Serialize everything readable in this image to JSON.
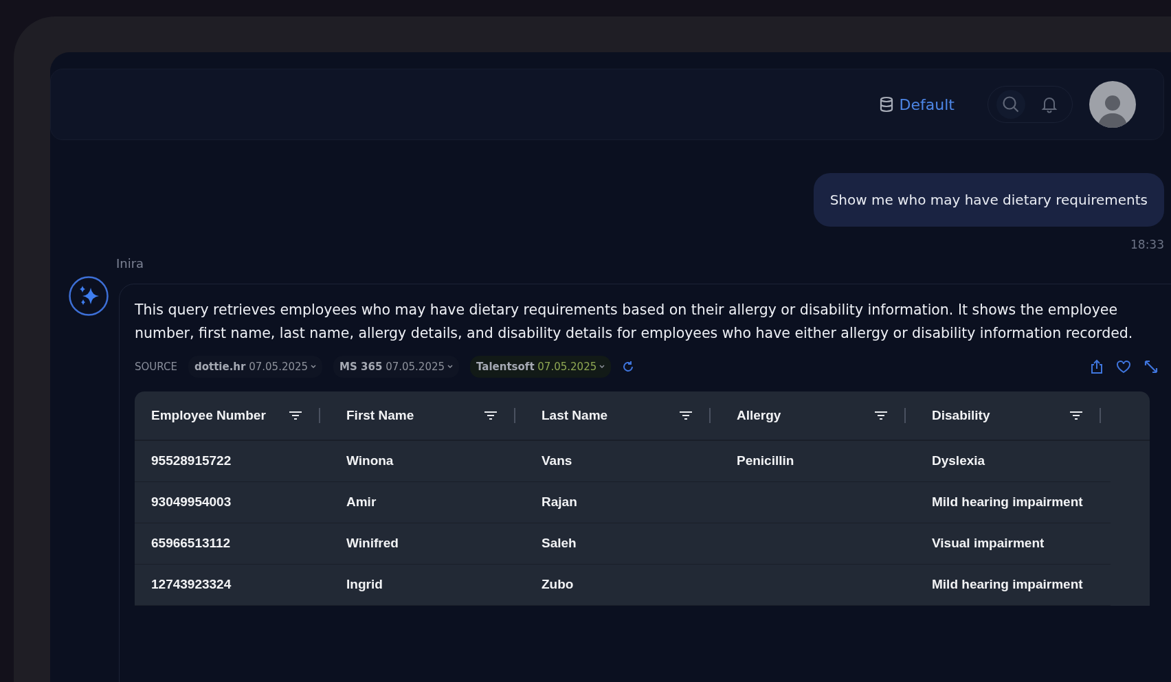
{
  "header": {
    "workspace": "Default"
  },
  "user_message": {
    "text": "Show me who may have dietary requirements",
    "time": "18:33"
  },
  "assistant": {
    "name": "Inira",
    "text": "This query retrieves employees who may have dietary requirements based on their allergy or disability information. It shows the employee number, first name, last name, allergy details, and disability details for employees who have either allergy or disability information recorded.",
    "source_label": "SOURCE",
    "sources": [
      {
        "name": "dottie.hr",
        "date": "07.05.2025",
        "active": false
      },
      {
        "name": "MS 365",
        "date": "07.05.2025",
        "active": false
      },
      {
        "name": "Talentsoft",
        "date": "07.05.2025",
        "active": true
      }
    ],
    "table": {
      "columns": [
        "Employee Number",
        "First Name",
        "Last Name",
        "Allergy",
        "Disability"
      ],
      "rows": [
        [
          "95528915722",
          "Winona",
          "Vans",
          "Penicillin",
          "Dyslexia"
        ],
        [
          "93049954003",
          "Amir",
          "Rajan",
          "",
          "Mild hearing impairment"
        ],
        [
          "65966513112",
          "Winifred",
          "Saleh",
          "",
          "Visual impairment"
        ],
        [
          "12743923324",
          "Ingrid",
          "Zubo",
          "",
          "Mild hearing impairment"
        ]
      ]
    }
  }
}
